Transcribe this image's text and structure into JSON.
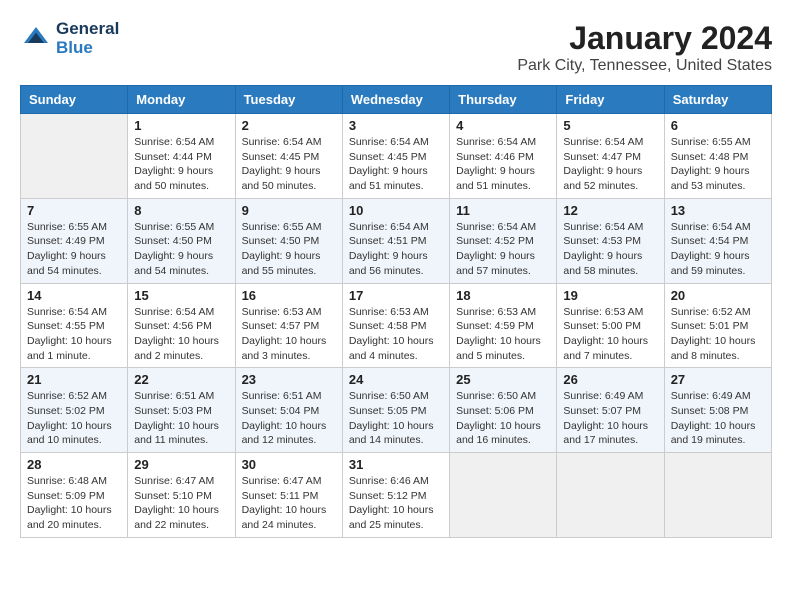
{
  "logo": {
    "line1": "General",
    "line2": "Blue"
  },
  "title": "January 2024",
  "subtitle": "Park City, Tennessee, United States",
  "days_of_week": [
    "Sunday",
    "Monday",
    "Tuesday",
    "Wednesday",
    "Thursday",
    "Friday",
    "Saturday"
  ],
  "weeks": [
    [
      {
        "day": "",
        "info": ""
      },
      {
        "day": "1",
        "info": "Sunrise: 6:54 AM\nSunset: 4:44 PM\nDaylight: 9 hours\nand 50 minutes."
      },
      {
        "day": "2",
        "info": "Sunrise: 6:54 AM\nSunset: 4:45 PM\nDaylight: 9 hours\nand 50 minutes."
      },
      {
        "day": "3",
        "info": "Sunrise: 6:54 AM\nSunset: 4:45 PM\nDaylight: 9 hours\nand 51 minutes."
      },
      {
        "day": "4",
        "info": "Sunrise: 6:54 AM\nSunset: 4:46 PM\nDaylight: 9 hours\nand 51 minutes."
      },
      {
        "day": "5",
        "info": "Sunrise: 6:54 AM\nSunset: 4:47 PM\nDaylight: 9 hours\nand 52 minutes."
      },
      {
        "day": "6",
        "info": "Sunrise: 6:55 AM\nSunset: 4:48 PM\nDaylight: 9 hours\nand 53 minutes."
      }
    ],
    [
      {
        "day": "7",
        "info": "Sunrise: 6:55 AM\nSunset: 4:49 PM\nDaylight: 9 hours\nand 54 minutes."
      },
      {
        "day": "8",
        "info": "Sunrise: 6:55 AM\nSunset: 4:50 PM\nDaylight: 9 hours\nand 54 minutes."
      },
      {
        "day": "9",
        "info": "Sunrise: 6:55 AM\nSunset: 4:50 PM\nDaylight: 9 hours\nand 55 minutes."
      },
      {
        "day": "10",
        "info": "Sunrise: 6:54 AM\nSunset: 4:51 PM\nDaylight: 9 hours\nand 56 minutes."
      },
      {
        "day": "11",
        "info": "Sunrise: 6:54 AM\nSunset: 4:52 PM\nDaylight: 9 hours\nand 57 minutes."
      },
      {
        "day": "12",
        "info": "Sunrise: 6:54 AM\nSunset: 4:53 PM\nDaylight: 9 hours\nand 58 minutes."
      },
      {
        "day": "13",
        "info": "Sunrise: 6:54 AM\nSunset: 4:54 PM\nDaylight: 9 hours\nand 59 minutes."
      }
    ],
    [
      {
        "day": "14",
        "info": "Sunrise: 6:54 AM\nSunset: 4:55 PM\nDaylight: 10 hours\nand 1 minute."
      },
      {
        "day": "15",
        "info": "Sunrise: 6:54 AM\nSunset: 4:56 PM\nDaylight: 10 hours\nand 2 minutes."
      },
      {
        "day": "16",
        "info": "Sunrise: 6:53 AM\nSunset: 4:57 PM\nDaylight: 10 hours\nand 3 minutes."
      },
      {
        "day": "17",
        "info": "Sunrise: 6:53 AM\nSunset: 4:58 PM\nDaylight: 10 hours\nand 4 minutes."
      },
      {
        "day": "18",
        "info": "Sunrise: 6:53 AM\nSunset: 4:59 PM\nDaylight: 10 hours\nand 5 minutes."
      },
      {
        "day": "19",
        "info": "Sunrise: 6:53 AM\nSunset: 5:00 PM\nDaylight: 10 hours\nand 7 minutes."
      },
      {
        "day": "20",
        "info": "Sunrise: 6:52 AM\nSunset: 5:01 PM\nDaylight: 10 hours\nand 8 minutes."
      }
    ],
    [
      {
        "day": "21",
        "info": "Sunrise: 6:52 AM\nSunset: 5:02 PM\nDaylight: 10 hours\nand 10 minutes."
      },
      {
        "day": "22",
        "info": "Sunrise: 6:51 AM\nSunset: 5:03 PM\nDaylight: 10 hours\nand 11 minutes."
      },
      {
        "day": "23",
        "info": "Sunrise: 6:51 AM\nSunset: 5:04 PM\nDaylight: 10 hours\nand 12 minutes."
      },
      {
        "day": "24",
        "info": "Sunrise: 6:50 AM\nSunset: 5:05 PM\nDaylight: 10 hours\nand 14 minutes."
      },
      {
        "day": "25",
        "info": "Sunrise: 6:50 AM\nSunset: 5:06 PM\nDaylight: 10 hours\nand 16 minutes."
      },
      {
        "day": "26",
        "info": "Sunrise: 6:49 AM\nSunset: 5:07 PM\nDaylight: 10 hours\nand 17 minutes."
      },
      {
        "day": "27",
        "info": "Sunrise: 6:49 AM\nSunset: 5:08 PM\nDaylight: 10 hours\nand 19 minutes."
      }
    ],
    [
      {
        "day": "28",
        "info": "Sunrise: 6:48 AM\nSunset: 5:09 PM\nDaylight: 10 hours\nand 20 minutes."
      },
      {
        "day": "29",
        "info": "Sunrise: 6:47 AM\nSunset: 5:10 PM\nDaylight: 10 hours\nand 22 minutes."
      },
      {
        "day": "30",
        "info": "Sunrise: 6:47 AM\nSunset: 5:11 PM\nDaylight: 10 hours\nand 24 minutes."
      },
      {
        "day": "31",
        "info": "Sunrise: 6:46 AM\nSunset: 5:12 PM\nDaylight: 10 hours\nand 25 minutes."
      },
      {
        "day": "",
        "info": ""
      },
      {
        "day": "",
        "info": ""
      },
      {
        "day": "",
        "info": ""
      }
    ]
  ]
}
